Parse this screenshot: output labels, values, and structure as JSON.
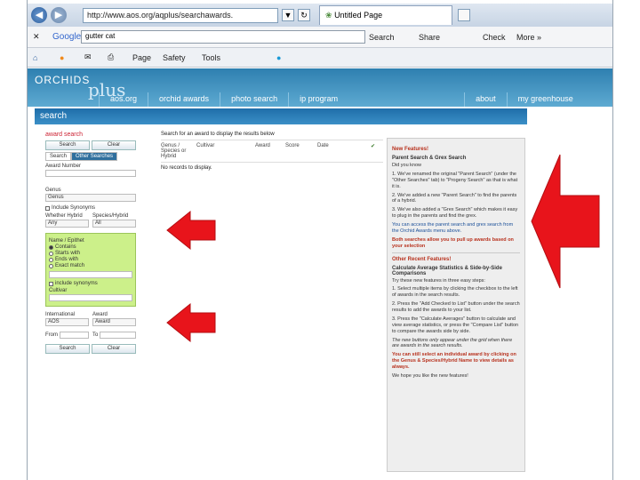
{
  "browser": {
    "url": "http://www.aos.org/aqplus/searchawards.",
    "tab_title": "Untitled Page",
    "google_label": "Google",
    "google_query": "gutter cat",
    "search_label": "Search",
    "share_label": "Share",
    "check_label": "Check",
    "more_label": "More »",
    "page_label": "Page",
    "safety_label": "Safety",
    "tools_label": "Tools",
    "back_icon": "back-arrow-icon",
    "forward_icon": "forward-arrow-icon"
  },
  "site": {
    "logo_text": "ORCHIDS",
    "logo_sub": "plus",
    "nav": [
      "aos.org",
      "orchid awards",
      "photo search",
      "ip program",
      "about",
      "my greenhouse"
    ],
    "section_title": "search"
  },
  "left_panel": {
    "title": "award search",
    "search_btn": "Search",
    "clear_btn": "Clear",
    "tab_search": "Search",
    "tab_other": "Other Searches",
    "award_number_label": "Award Number",
    "genus_label": "Genus",
    "genus_value": "Genus",
    "include_synonyms": "Include Synonyms",
    "hybrid_label": "Whether Hybrid",
    "species_hybrid_label": "Species/Hybrid",
    "whether_value": "Any",
    "species_value": "All",
    "name_epithet_label": "Name / Epithet",
    "radios": [
      "Contains",
      "Starts with",
      "Ends with",
      "Exact match"
    ],
    "name_synonyms": "include synonyms",
    "cultivar_label": "Cultivar",
    "international_label": "International",
    "award_label": "Award",
    "intl_value": "AOS",
    "award_value": "Award",
    "from_label": "From",
    "to_label": "To",
    "search_btn2": "Search",
    "clear_btn2": "Clear"
  },
  "results": {
    "instruction": "Search for an award to display the results below",
    "columns": [
      "Genus / Species or Hybrid",
      "Cultivar",
      "Award",
      "Score",
      "Date"
    ],
    "empty": "No records to display."
  },
  "right_panel": {
    "h1": "New Features!",
    "h2": "Parent Search & Grex Search",
    "intro": "Did you know",
    "p1": "1. We've renamed the original \"Parent Search\" (under the \"Other Searches\" tab) to \"Progeny Search\" as that is what it is.",
    "p2": "2. We've added a new \"Parent Search\" to find the parents of a hybrid.",
    "p3": "3. We've also added a \"Grex Search\" which makes it easy to plug in the parents and find the grex.",
    "p4": "You can access the parent search and grex search from the Orchid Awards menu above.",
    "p5": "Both searches allow you to pull up awards based on your selection",
    "h3": "Other Recent Features!",
    "h4": "Calculate Average Statistics & Side-by-Side Comparisons",
    "p6": "Try these new features in three easy steps:",
    "p7": "1. Select multiple items by clicking the checkbox to the left of awards in the search results.",
    "p8": "2. Press the \"Add Checked to List\" button under the search results to add the awards to your list.",
    "p9": "3. Press the \"Calculate Averages\" button to calculate and view average statistics, or press the \"Compare List\" button to compare the awards side by side.",
    "p10": "The new buttons only appear under the grid when there are awards in the search results.",
    "p11": "You can still select an individual award by clicking on the Genus & Species/Hybrid Name to view details as always.",
    "p12": "We hope you like the new features!"
  },
  "colors": {
    "arrow": "#e8141b",
    "header": "#3b8fc7",
    "green_panel": "#ccf08a"
  }
}
